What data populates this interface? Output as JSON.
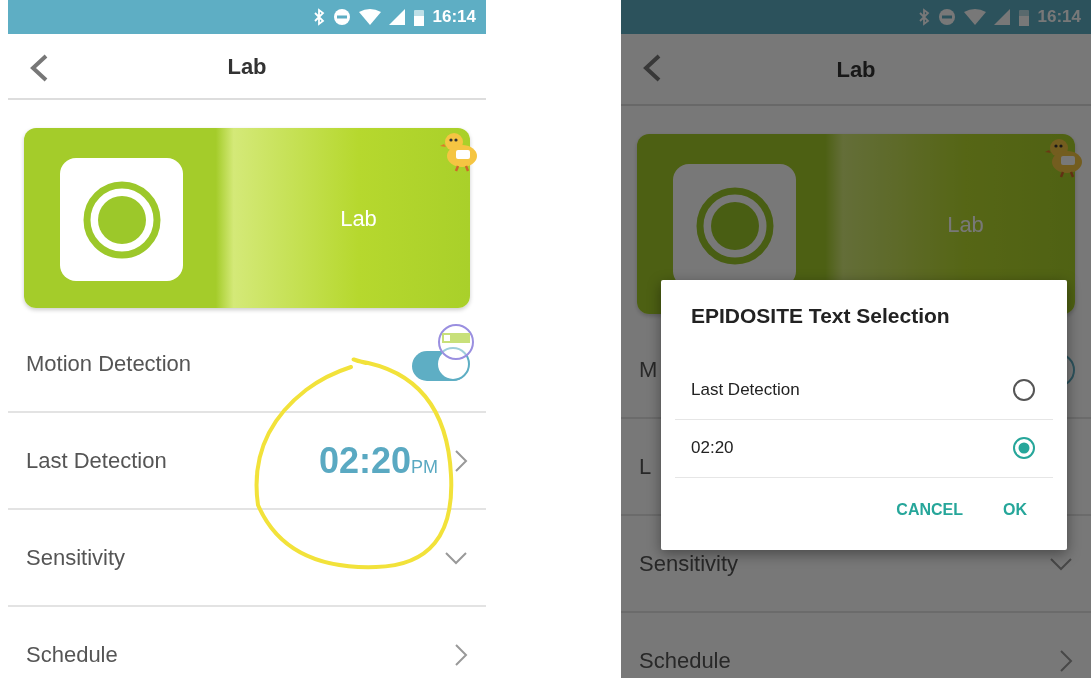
{
  "phones": [
    {
      "dimmed": false,
      "status_bar": {
        "time": "16:14"
      },
      "header": {
        "title": "Lab"
      },
      "device_card": {
        "label": "Lab"
      },
      "rows": [
        {
          "kind": "toggle",
          "label": "Motion Detection",
          "on": true,
          "magnified": true
        },
        {
          "kind": "time",
          "label": "Last Detection",
          "time": "02:20",
          "suffix": "PM",
          "circled": true
        },
        {
          "kind": "dropdown",
          "label": "Sensitivity"
        },
        {
          "kind": "link",
          "label": "Schedule"
        }
      ]
    },
    {
      "dimmed": true,
      "status_bar": {
        "time": "16:14"
      },
      "header": {
        "title": "Lab"
      },
      "device_card": {
        "label": "Lab"
      },
      "rows": [
        {
          "kind": "toggle",
          "label": "M",
          "on": true
        },
        {
          "kind": "plain",
          "label": "L"
        },
        {
          "kind": "dropdown",
          "label": "Sensitivity"
        },
        {
          "kind": "link",
          "label": "Schedule"
        }
      ],
      "dialog": {
        "title": "EPIDOSITE Text Selection",
        "options": [
          {
            "label": "Last Detection",
            "selected": false
          },
          {
            "label": "02:20",
            "selected": true
          }
        ],
        "buttons": [
          "CANCEL",
          "OK"
        ]
      }
    }
  ]
}
